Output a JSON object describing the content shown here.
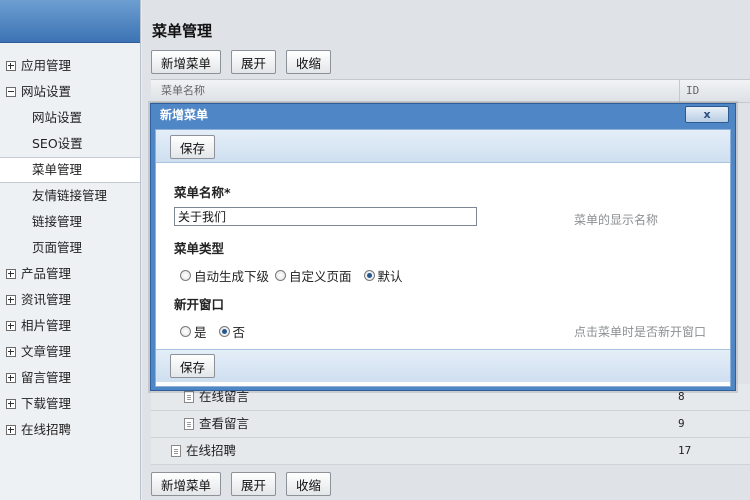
{
  "sidebar": {
    "items": [
      {
        "label": "应用管理",
        "level": "top",
        "icon": "plus-box-icon"
      },
      {
        "label": "网站设置",
        "level": "top",
        "icon": "minus-box-icon"
      },
      {
        "label": "网站设置",
        "level": "sub"
      },
      {
        "label": "SEO设置",
        "level": "sub"
      },
      {
        "label": "菜单管理",
        "level": "sub",
        "active": true
      },
      {
        "label": "友情链接管理",
        "level": "sub"
      },
      {
        "label": "链接管理",
        "level": "sub"
      },
      {
        "label": "页面管理",
        "level": "sub"
      },
      {
        "label": "产品管理",
        "level": "top",
        "icon": "plus-box-icon"
      },
      {
        "label": "资讯管理",
        "level": "top",
        "icon": "plus-box-icon"
      },
      {
        "label": "相片管理",
        "level": "top",
        "icon": "plus-box-icon"
      },
      {
        "label": "文章管理",
        "level": "top",
        "icon": "plus-box-icon"
      },
      {
        "label": "留言管理",
        "level": "top",
        "icon": "plus-box-icon"
      },
      {
        "label": "下载管理",
        "level": "top",
        "icon": "plus-box-icon"
      },
      {
        "label": "在线招聘",
        "level": "top",
        "icon": "plus-box-icon"
      }
    ]
  },
  "main": {
    "title": "菜单管理",
    "toolbar": {
      "add_label": "新增菜单",
      "expand_label": "展开",
      "collapse_label": "收缩"
    },
    "grid": {
      "header": {
        "name": "菜单名称",
        "id": "ID"
      },
      "rows": [
        {
          "name": "在线留言",
          "id": "8"
        },
        {
          "name": "查看留言",
          "id": "9"
        },
        {
          "name": "在线招聘",
          "id": "17"
        }
      ]
    }
  },
  "modal": {
    "title": "新增菜单",
    "close_label": "x",
    "save_label": "保存",
    "fields": {
      "name_label": "菜单名称*",
      "name_value": "关于我们",
      "name_hint": "菜单的显示名称",
      "type_label": "菜单类型",
      "type_options": [
        "自动生成下级",
        "自定义页面",
        "默认"
      ],
      "type_selected": "默认",
      "window_label": "新开窗口",
      "window_options": [
        "是",
        "否"
      ],
      "window_selected": "否",
      "window_hint": "点击菜单时是否新开窗口"
    }
  }
}
